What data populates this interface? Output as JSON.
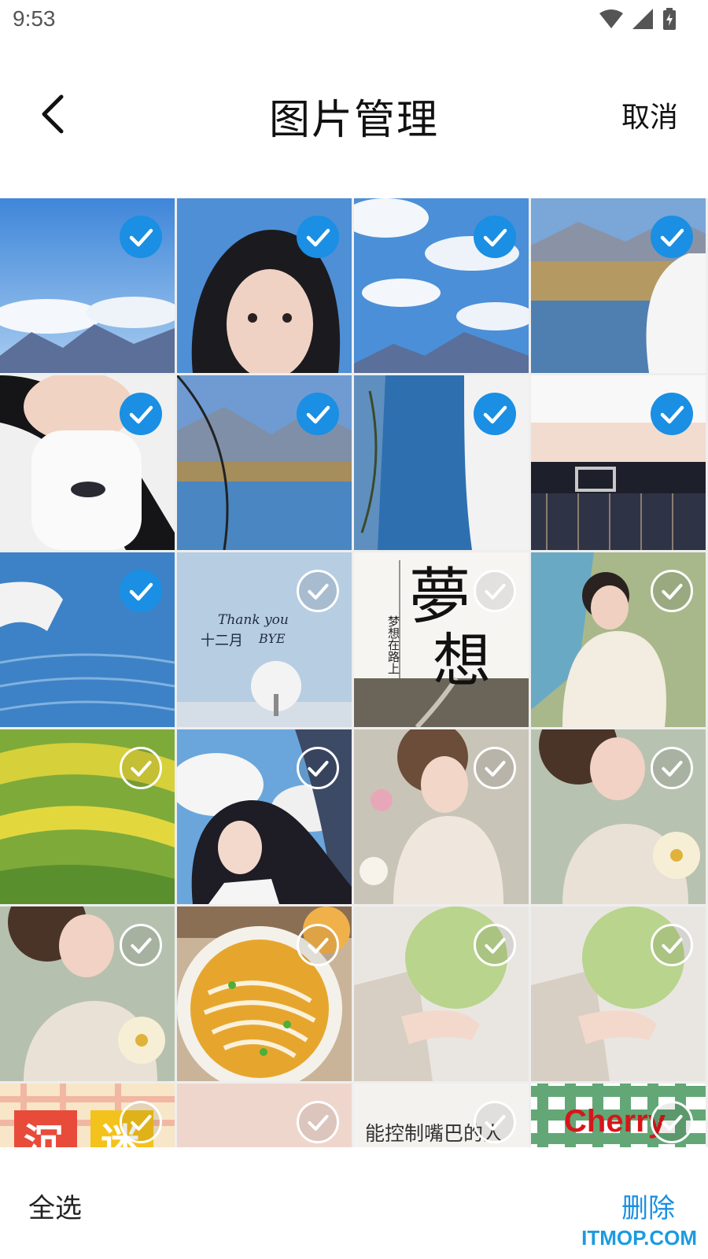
{
  "status_bar": {
    "time": "9:53",
    "icons": [
      "wifi-icon",
      "signal-icon",
      "battery-charging-icon"
    ]
  },
  "header": {
    "back_icon": "chevron-left-icon",
    "title": "图片管理",
    "cancel_label": "取消"
  },
  "grid": {
    "accent_color": "#1a8fe3",
    "cells": [
      {
        "scene": "sky-mountains",
        "selected": true
      },
      {
        "scene": "girl-face",
        "selected": true
      },
      {
        "scene": "sky-clouds",
        "selected": true
      },
      {
        "scene": "lake-hills-figure",
        "selected": true
      },
      {
        "scene": "white-shirt-hair",
        "selected": true
      },
      {
        "scene": "lake-mountains",
        "selected": true
      },
      {
        "scene": "water-branch",
        "selected": true
      },
      {
        "scene": "crop-top-belt",
        "selected": true
      },
      {
        "scene": "water-arm",
        "selected": true
      },
      {
        "scene": "winter-tree-text",
        "selected": false,
        "text_1": "Thank you",
        "text_2": "十二月",
        "text_3": "BYE"
      },
      {
        "scene": "dream-poster",
        "selected": false,
        "text_1": "夢",
        "text_2": "想",
        "text_3": "梦想在路上"
      },
      {
        "scene": "anime-lady",
        "selected": false
      },
      {
        "scene": "flower-field",
        "selected": false
      },
      {
        "scene": "anime-girl-sky",
        "selected": false
      },
      {
        "scene": "lady-flowers",
        "selected": false
      },
      {
        "scene": "lady-lily",
        "selected": false
      },
      {
        "scene": "lady-lily-2",
        "selected": false
      },
      {
        "scene": "noodle-soup",
        "selected": false
      },
      {
        "scene": "green-mochi",
        "selected": false
      },
      {
        "scene": "green-mochi-2",
        "selected": false
      },
      {
        "scene": "plaid-text",
        "selected": false,
        "text_1": "沉",
        "text_2": "迷"
      },
      {
        "scene": "blank-pink",
        "selected": false
      },
      {
        "scene": "handwriting",
        "selected": false,
        "text_1": "能控制嘴巴的人"
      },
      {
        "scene": "green-gingham",
        "selected": false,
        "text_1": "Cherry"
      }
    ]
  },
  "bottom_bar": {
    "select_all_label": "全选",
    "delete_label": "删除"
  },
  "watermark": "ITMOP.COM"
}
